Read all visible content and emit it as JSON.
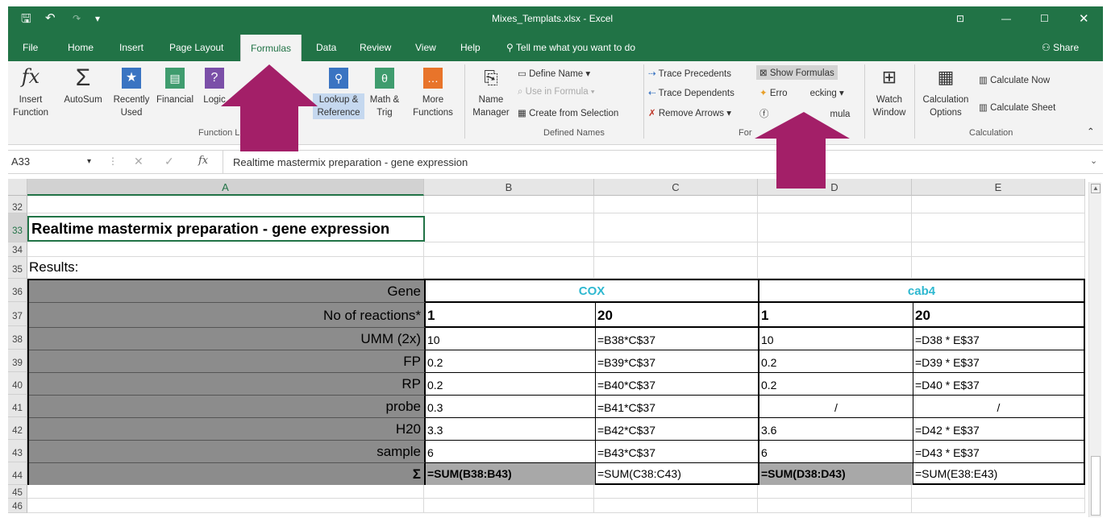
{
  "window": {
    "title": "Mixes_Templats.xlsx  -  Excel",
    "share": "Share"
  },
  "tabs": [
    "File",
    "Home",
    "Insert",
    "Page Layout",
    "Formulas",
    "Data",
    "Review",
    "View",
    "Help"
  ],
  "tell_me": "Tell me what you want to do",
  "ribbon": {
    "insert_function": "Insert Function",
    "autosum": "AutoSum",
    "recently_used": "Recently Used",
    "financial": "Financial",
    "logical": "Logic",
    "lookup": "Lookup & Reference",
    "math": "Math & Trig",
    "more": "More Functions",
    "function_library": "Function L",
    "name_manager": "Name Manager",
    "define_name": "Define Name",
    "use_in_formula": "Use in Formula",
    "create_from_selection": "Create from Selection",
    "defined_names": "Defined Names",
    "trace_precedents": "Trace Precedents",
    "trace_dependents": "Trace Dependents",
    "remove_arrows": "Remove Arrows",
    "show_formulas": "Show Formulas",
    "error_checking_a": "Erro",
    "error_checking_b": "ecking",
    "evaluate_formula": "mula",
    "formula_auditing": "For",
    "watch_window": "Watch Window",
    "calc_options": "Calculation Options",
    "calc_now": "Calculate Now",
    "calc_sheet": "Calculate Sheet",
    "calculation": "Calculation"
  },
  "formula_bar": {
    "name_box": "A33",
    "fx": "fx",
    "content": "Realtime mastermix preparation - gene expression"
  },
  "columns": [
    "A",
    "B",
    "C",
    "D",
    "E"
  ],
  "rows": [
    "32",
    "33",
    "34",
    "35",
    "36",
    "37",
    "38",
    "39",
    "40",
    "41",
    "42",
    "43",
    "44",
    "45",
    "46"
  ],
  "sheet": {
    "title": "Realtime mastermix preparation - gene expression",
    "results": "Results:",
    "gene_label": "Gene",
    "gene1": "COX",
    "gene2": "cab4",
    "reactions_label": "No of reactions*",
    "r1": "1",
    "r2": "20",
    "r3": "1",
    "r4": "20",
    "rows": [
      {
        "label": "UMM (2x)",
        "b": "10",
        "c": "=B38*C$37",
        "d": "10",
        "e": "=D38 * E$37"
      },
      {
        "label": "FP",
        "b": "0.2",
        "c": "=B39*C$37",
        "d": "0.2",
        "e": "=D39 * E$37"
      },
      {
        "label": "RP",
        "b": "0.2",
        "c": "=B40*C$37",
        "d": "0.2",
        "e": "=D40 * E$37"
      },
      {
        "label": "probe",
        "b": "0.3",
        "c": "=B41*C$37",
        "d": "/",
        "e": "/"
      },
      {
        "label": "H20",
        "b": "3.3",
        "c": "=B42*C$37",
        "d": "3.6",
        "e": "=D42 * E$37"
      },
      {
        "label": "sample",
        "b": "6",
        "c": "=B43*C$37",
        "d": "6",
        "e": "=D43 * E$37"
      }
    ],
    "sum_label": "Σ",
    "sum_b": "=SUM(B38:B43)",
    "sum_c": "=SUM(C38:C43)",
    "sum_d": "=SUM(D38:D43)",
    "sum_e": "=SUM(E38:E43)"
  },
  "colors": {
    "excel_green": "#217346",
    "gene_color": "#2eb8d0",
    "arrow_color": "#a31f68"
  }
}
